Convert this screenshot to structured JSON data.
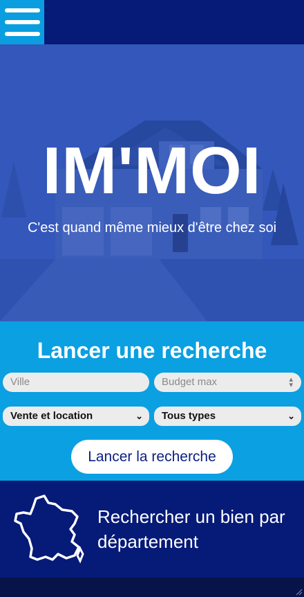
{
  "header": {
    "menu_icon": "hamburger-icon"
  },
  "hero": {
    "brand": "IM'MOI",
    "tagline": "C'est quand même mieux d'être chez soi"
  },
  "search": {
    "title": "Lancer une recherche",
    "city_placeholder": "Ville",
    "budget_placeholder": "Budget max",
    "transaction_selected": "Vente et location",
    "type_selected": "Tous types",
    "submit_label": "Lancer la recherche"
  },
  "department": {
    "label": "Rechercher un bien par département",
    "icon": "france-map-icon"
  },
  "colors": {
    "dark_blue": "#061a78",
    "light_blue": "#0aa0e2",
    "white": "#ffffff"
  }
}
